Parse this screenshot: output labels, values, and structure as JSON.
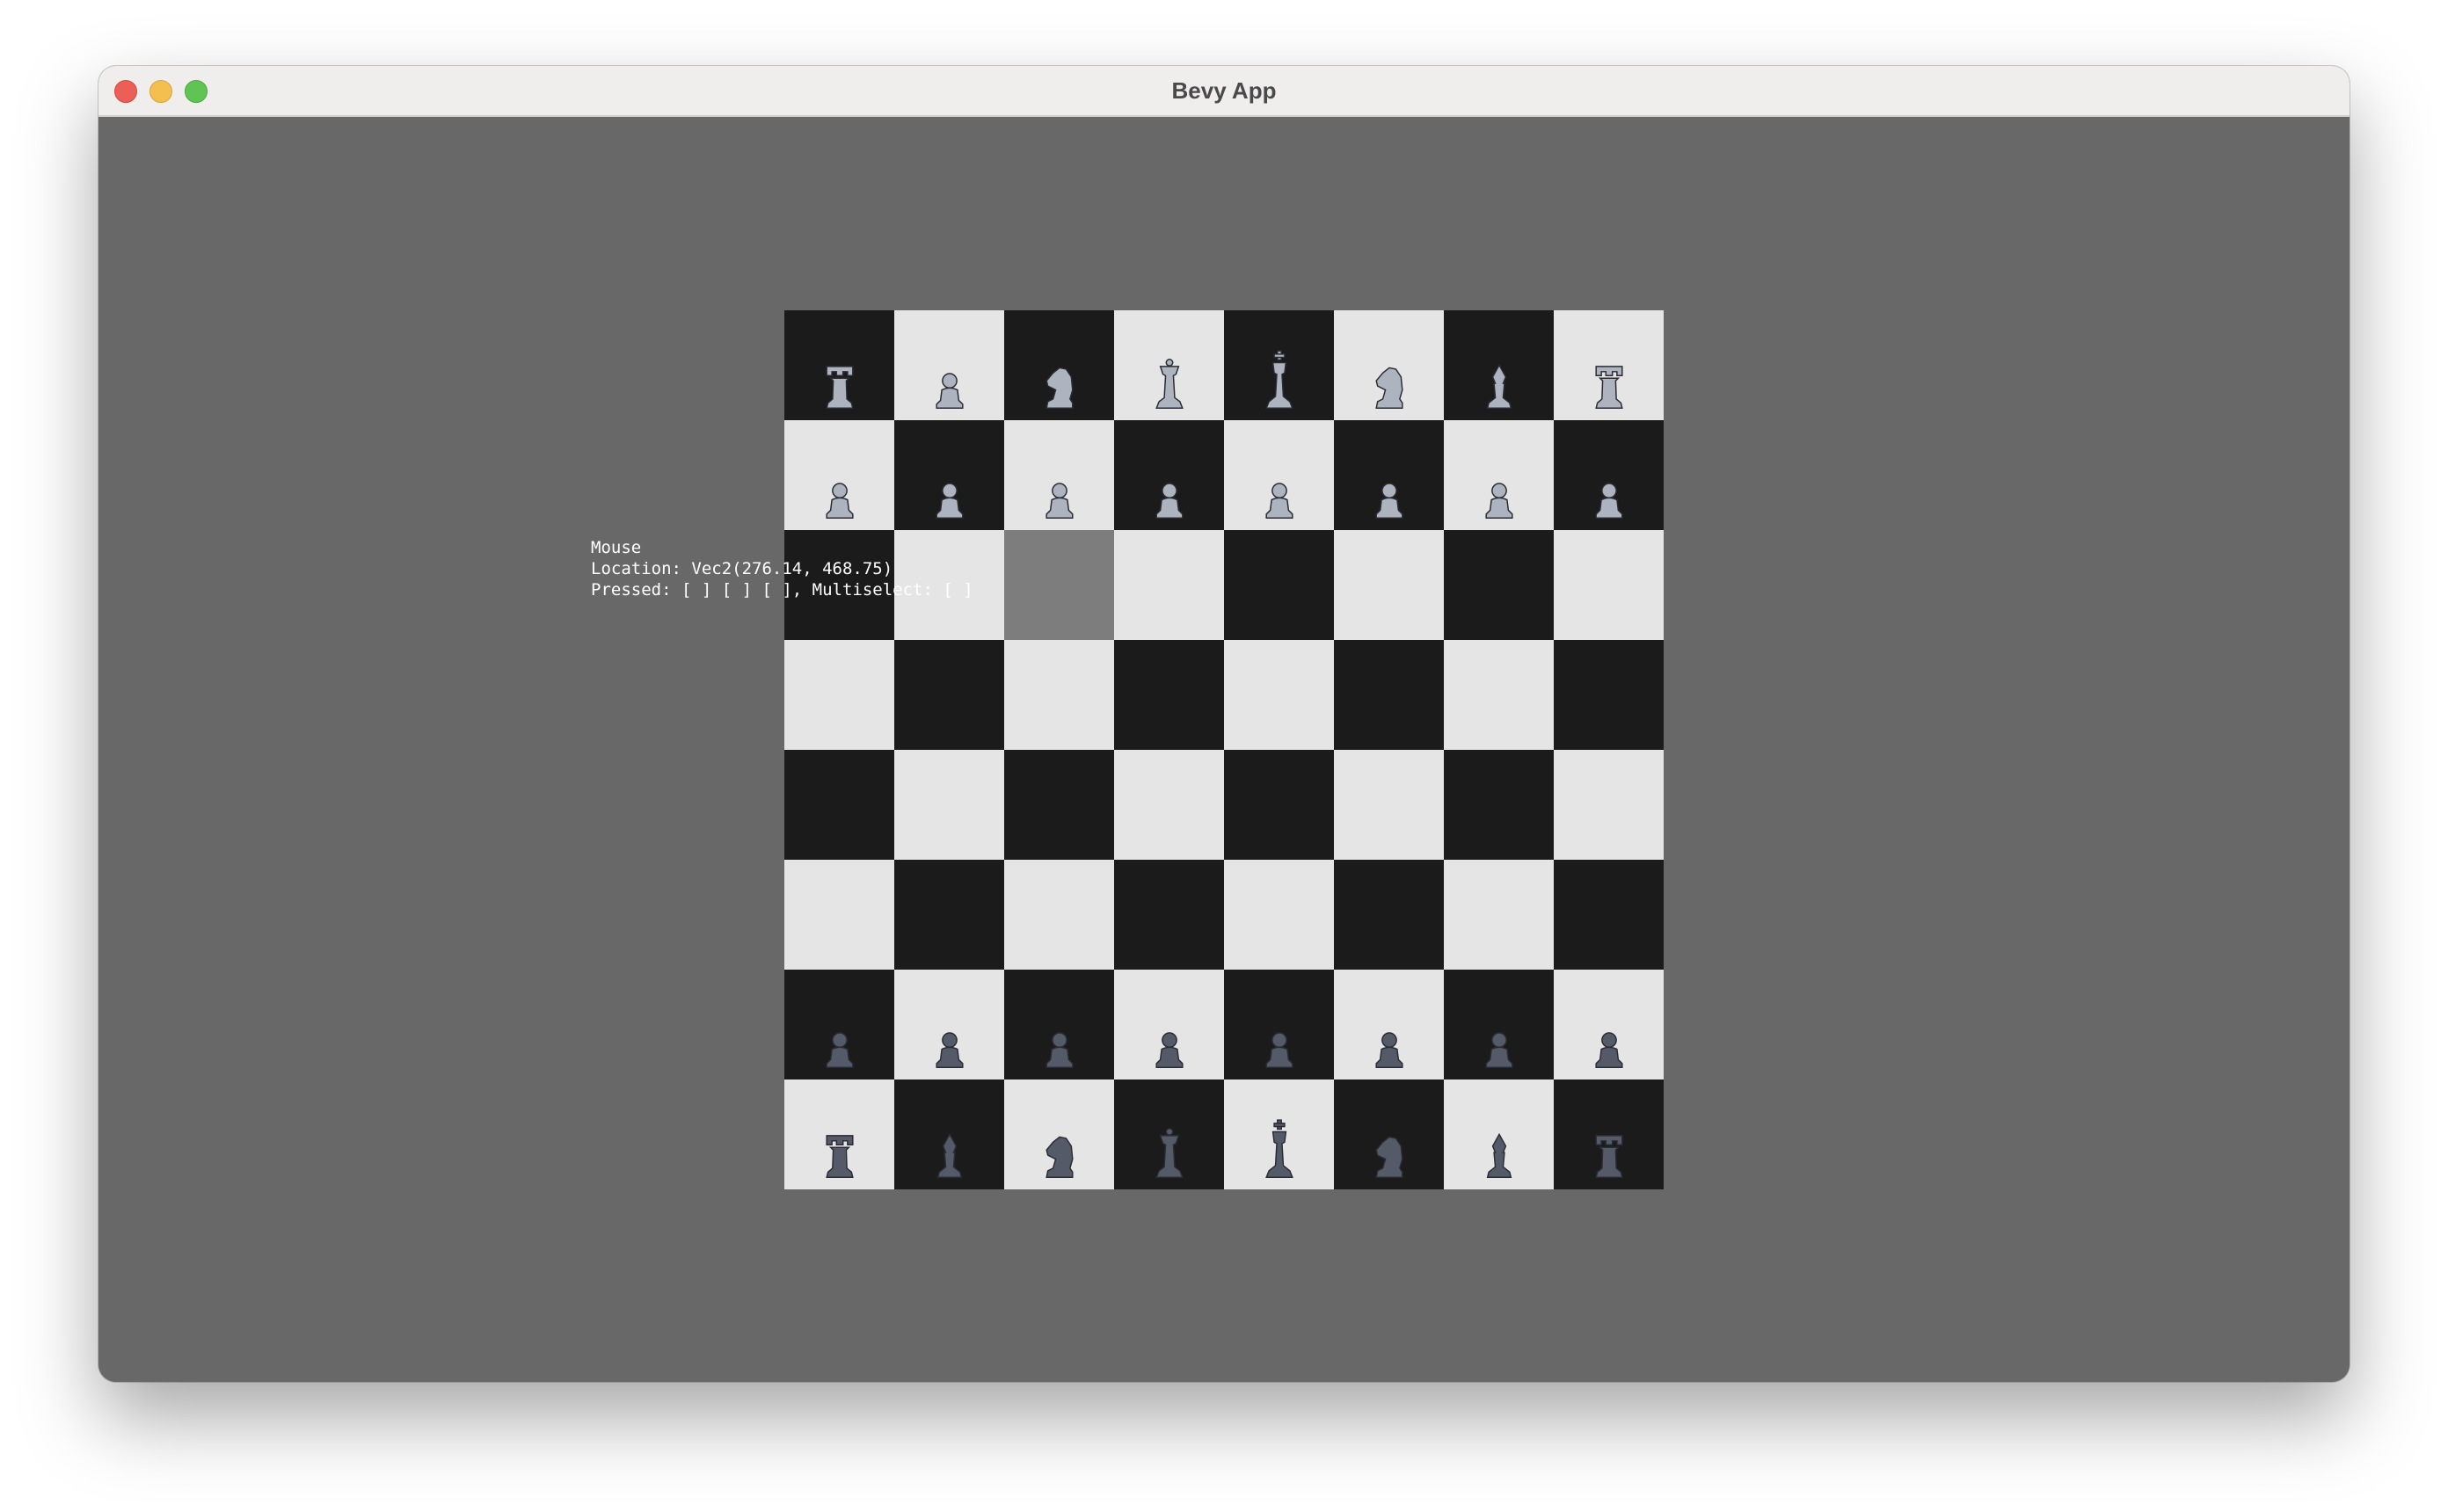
{
  "window": {
    "title": "Bevy App"
  },
  "hud": {
    "line1": "Mouse",
    "line2": "Location: Vec2(276.14, 468.75)",
    "line3": "Pressed: [ ] [ ] [ ], Multiselect: [ ]"
  },
  "colors": {
    "background": "#686868",
    "dark_square": "#1b1b1b",
    "light_square": "#e5e5e5",
    "highlight_square": "#7d7d7d",
    "white_piece": "#aeb3c0",
    "black_piece": "#555a68"
  },
  "board": {
    "highlighted_square": "c6",
    "rows": [
      [
        "rook",
        "pawn",
        "knight",
        "queen",
        "king",
        "knight",
        "bishop",
        "rook"
      ],
      [
        "pawn",
        "pawn",
        "pawn",
        "pawn",
        "pawn",
        "pawn",
        "pawn",
        "pawn"
      ],
      [
        "",
        "",
        "",
        "",
        "",
        "",
        "",
        ""
      ],
      [
        "",
        "",
        "",
        "",
        "",
        "",
        "",
        ""
      ],
      [
        "",
        "",
        "",
        "",
        "",
        "",
        "",
        ""
      ],
      [
        "",
        "",
        "",
        "",
        "",
        "",
        "",
        ""
      ],
      [
        "pawn",
        "pawn",
        "pawn",
        "pawn",
        "pawn",
        "pawn",
        "pawn",
        "pawn"
      ],
      [
        "rook",
        "bishop",
        "knight",
        "queen",
        "king",
        "knight",
        "bishop",
        "rook"
      ]
    ],
    "row_sides": [
      "light",
      "light",
      "",
      "",
      "",
      "",
      "dark",
      "dark"
    ]
  }
}
